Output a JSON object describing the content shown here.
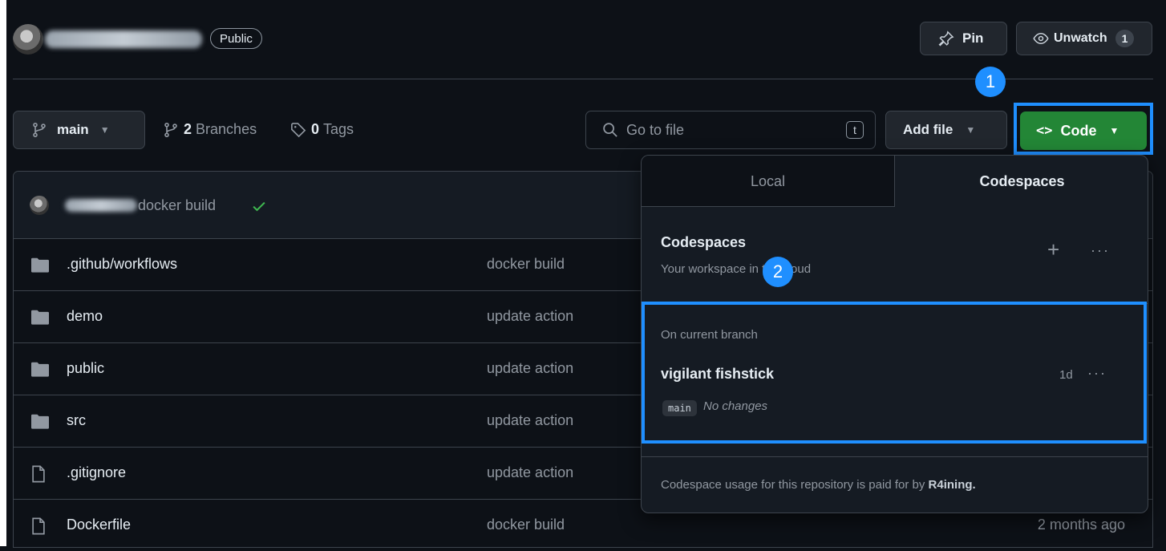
{
  "repo": {
    "visibility": "Public"
  },
  "header_actions": {
    "pin_label": "Pin",
    "unwatch_label": "Unwatch",
    "watch_count": "1"
  },
  "toolbar": {
    "branch": "main",
    "branches_count": "2",
    "branches_label": "Branches",
    "tags_count": "0",
    "tags_label": "Tags",
    "search_placeholder": "Go to file",
    "search_shortcut": "t",
    "add_file_label": "Add file",
    "code_label": "Code"
  },
  "commit": {
    "message": "docker build"
  },
  "files": [
    {
      "name": ".github/workflows",
      "type": "folder",
      "message": "docker build",
      "time": ""
    },
    {
      "name": "demo",
      "type": "folder",
      "message": "update action",
      "time": ""
    },
    {
      "name": "public",
      "type": "folder",
      "message": "update action",
      "time": ""
    },
    {
      "name": "src",
      "type": "folder",
      "message": "update action",
      "time": ""
    },
    {
      "name": ".gitignore",
      "type": "file",
      "message": "update action",
      "time": ""
    },
    {
      "name": "Dockerfile",
      "type": "file",
      "message": "docker build",
      "time": "2 months ago"
    }
  ],
  "annotations": {
    "step1": "1",
    "step2": "2"
  },
  "codespaces_panel": {
    "tabs": [
      "Local",
      "Codespaces"
    ],
    "active_tab": "Codespaces",
    "title": "Codespaces",
    "subtitle": "Your workspace in the cloud",
    "section_label": "On current branch",
    "codespace": {
      "name": "vigilant fishstick",
      "age": "1d",
      "branch": "main",
      "status": "No changes"
    },
    "footer_prefix": "Codespace usage for this repository is paid for by ",
    "footer_owner": "R4ining."
  },
  "colors": {
    "accent": "#1f8fff",
    "code_button": "#238636",
    "check": "#3fb950"
  }
}
